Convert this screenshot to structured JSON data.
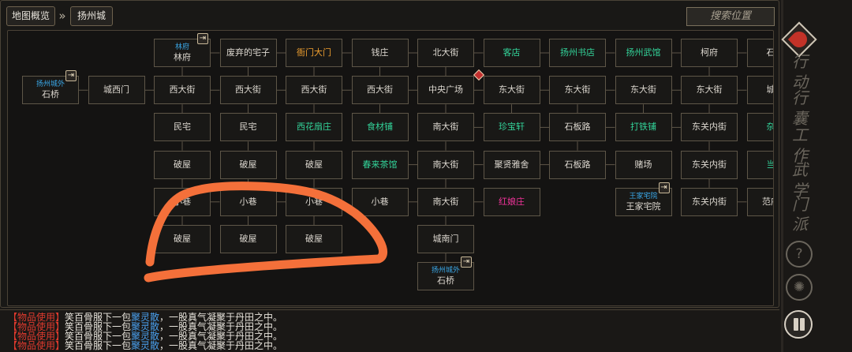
{
  "header": {
    "overview_label": "地图概览",
    "city_label": "扬州城",
    "search_placeholder": "搜索位置"
  },
  "map": {
    "nodes": [
      {
        "id": "r0c0",
        "row": 0,
        "col": 2,
        "name": "林府",
        "sub": "林府",
        "exit": true
      },
      {
        "id": "r0c1",
        "row": 0,
        "col": 3,
        "name": "废弃的宅子"
      },
      {
        "id": "r0c2",
        "row": 0,
        "col": 4,
        "name": "衙门大门",
        "style": "orange"
      },
      {
        "id": "r0c3",
        "row": 0,
        "col": 5,
        "name": "钱庄"
      },
      {
        "id": "r0c4",
        "row": 0,
        "col": 6,
        "name": "北大街"
      },
      {
        "id": "r0c5",
        "row": 0,
        "col": 7,
        "name": "客店",
        "style": "green"
      },
      {
        "id": "r0c6",
        "row": 0,
        "col": 8,
        "name": "扬州书店",
        "style": "green"
      },
      {
        "id": "r0c7",
        "row": 0,
        "col": 9,
        "name": "扬州武馆",
        "style": "green"
      },
      {
        "id": "r0c8",
        "row": 0,
        "col": 10,
        "name": "柯府"
      },
      {
        "id": "r0c9",
        "row": 0,
        "col": 11,
        "name": "石板"
      },
      {
        "id": "r1c0",
        "row": 1,
        "col": 0,
        "name": "石桥",
        "sub": "扬州城外",
        "exit": true
      },
      {
        "id": "r1c1",
        "row": 1,
        "col": 1,
        "name": "城西门"
      },
      {
        "id": "r1c2",
        "row": 1,
        "col": 2,
        "name": "西大街"
      },
      {
        "id": "r1c3",
        "row": 1,
        "col": 3,
        "name": "西大街"
      },
      {
        "id": "r1c4",
        "row": 1,
        "col": 4,
        "name": "西大街"
      },
      {
        "id": "r1c5",
        "row": 1,
        "col": 5,
        "name": "西大街"
      },
      {
        "id": "r1c6",
        "row": 1,
        "col": 6,
        "name": "中央广场",
        "marker": true
      },
      {
        "id": "r1c7",
        "row": 1,
        "col": 7,
        "name": "东大街"
      },
      {
        "id": "r1c8",
        "row": 1,
        "col": 8,
        "name": "东大街"
      },
      {
        "id": "r1c9",
        "row": 1,
        "col": 9,
        "name": "东大街"
      },
      {
        "id": "r1c10",
        "row": 1,
        "col": 10,
        "name": "东大街"
      },
      {
        "id": "r1c11",
        "row": 1,
        "col": 11,
        "name": "城东"
      },
      {
        "id": "r2c2",
        "row": 2,
        "col": 2,
        "name": "民宅"
      },
      {
        "id": "r2c3",
        "row": 2,
        "col": 3,
        "name": "民宅"
      },
      {
        "id": "r2c4",
        "row": 2,
        "col": 4,
        "name": "西花扇庄",
        "style": "green"
      },
      {
        "id": "r2c5",
        "row": 2,
        "col": 5,
        "name": "食材铺",
        "style": "green"
      },
      {
        "id": "r2c6",
        "row": 2,
        "col": 6,
        "name": "南大街"
      },
      {
        "id": "r2c7",
        "row": 2,
        "col": 7,
        "name": "珍宝轩",
        "style": "green"
      },
      {
        "id": "r2c8",
        "row": 2,
        "col": 8,
        "name": "石板路"
      },
      {
        "id": "r2c9",
        "row": 2,
        "col": 9,
        "name": "打铁铺",
        "style": "green"
      },
      {
        "id": "r2c10",
        "row": 2,
        "col": 10,
        "name": "东关内街"
      },
      {
        "id": "r2c11",
        "row": 2,
        "col": 11,
        "name": "杂货",
        "style": "green"
      },
      {
        "id": "r3c2",
        "row": 3,
        "col": 2,
        "name": "破屋"
      },
      {
        "id": "r3c3",
        "row": 3,
        "col": 3,
        "name": "破屋"
      },
      {
        "id": "r3c4",
        "row": 3,
        "col": 4,
        "name": "破屋"
      },
      {
        "id": "r3c5",
        "row": 3,
        "col": 5,
        "name": "春来茶馆",
        "style": "green"
      },
      {
        "id": "r3c6",
        "row": 3,
        "col": 6,
        "name": "南大街"
      },
      {
        "id": "r3c7",
        "row": 3,
        "col": 7,
        "name": "聚贤雅舍"
      },
      {
        "id": "r3c8",
        "row": 3,
        "col": 8,
        "name": "石板路"
      },
      {
        "id": "r3c9",
        "row": 3,
        "col": 9,
        "name": "赌场"
      },
      {
        "id": "r3c10",
        "row": 3,
        "col": 10,
        "name": "东关内街"
      },
      {
        "id": "r3c11",
        "row": 3,
        "col": 11,
        "name": "当铺",
        "style": "green"
      },
      {
        "id": "r4c2",
        "row": 4,
        "col": 2,
        "name": "小巷"
      },
      {
        "id": "r4c3",
        "row": 4,
        "col": 3,
        "name": "小巷"
      },
      {
        "id": "r4c4",
        "row": 4,
        "col": 4,
        "name": "小巷"
      },
      {
        "id": "r4c5",
        "row": 4,
        "col": 5,
        "name": "小巷"
      },
      {
        "id": "r4c6",
        "row": 4,
        "col": 6,
        "name": "南大街"
      },
      {
        "id": "r4c7",
        "row": 4,
        "col": 7,
        "name": "红娘庄",
        "style": "pink"
      },
      {
        "id": "r4c9",
        "row": 4,
        "col": 9,
        "name": "王家宅院",
        "sub": "王家宅院",
        "exit": true
      },
      {
        "id": "r4c10",
        "row": 4,
        "col": 10,
        "name": "东关内街"
      },
      {
        "id": "r4c11",
        "row": 4,
        "col": 11,
        "name": "范府门"
      },
      {
        "id": "r5c2",
        "row": 5,
        "col": 2,
        "name": "破屋"
      },
      {
        "id": "r5c3",
        "row": 5,
        "col": 3,
        "name": "破屋"
      },
      {
        "id": "r5c4",
        "row": 5,
        "col": 4,
        "name": "破屋"
      },
      {
        "id": "r5c6",
        "row": 5,
        "col": 6,
        "name": "城南门"
      },
      {
        "id": "r6c6",
        "row": 6,
        "col": 6,
        "name": "石桥",
        "sub": "扬州城外",
        "exit": true
      }
    ],
    "links_h": [
      [
        1,
        0,
        1
      ],
      [
        1,
        1,
        2
      ],
      [
        1,
        2,
        3
      ],
      [
        1,
        3,
        4
      ],
      [
        1,
        4,
        5
      ],
      [
        1,
        5,
        6
      ],
      [
        1,
        6,
        7
      ],
      [
        1,
        7,
        8
      ],
      [
        1,
        8,
        9
      ],
      [
        1,
        9,
        10
      ],
      [
        1,
        10,
        11
      ],
      [
        0,
        2,
        3
      ],
      [
        0,
        3,
        4
      ],
      [
        0,
        4,
        5
      ],
      [
        0,
        5,
        6
      ],
      [
        0,
        6,
        7
      ],
      [
        0,
        7,
        8
      ],
      [
        0,
        8,
        9
      ],
      [
        0,
        9,
        10
      ],
      [
        0,
        10,
        11
      ],
      [
        2,
        6,
        7
      ],
      [
        2,
        7,
        8
      ],
      [
        2,
        8,
        9
      ],
      [
        2,
        9,
        10
      ],
      [
        3,
        5,
        6
      ],
      [
        3,
        6,
        7
      ],
      [
        3,
        7,
        8
      ],
      [
        3,
        8,
        9
      ],
      [
        4,
        2,
        3
      ],
      [
        4,
        3,
        4
      ],
      [
        4,
        5,
        6
      ],
      [
        4,
        6,
        7
      ],
      [
        4,
        10,
        11
      ]
    ],
    "links_v": [
      [
        2,
        0,
        1
      ],
      [
        2,
        1,
        2
      ],
      [
        2,
        2,
        3
      ],
      [
        2,
        3,
        4
      ],
      [
        2,
        4,
        5
      ],
      [
        3,
        0,
        1
      ],
      [
        3,
        1,
        2
      ],
      [
        3,
        2,
        3
      ],
      [
        3,
        3,
        4
      ],
      [
        3,
        4,
        5
      ],
      [
        4,
        0,
        1
      ],
      [
        4,
        1,
        2
      ],
      [
        4,
        2,
        3
      ],
      [
        4,
        3,
        4
      ],
      [
        4,
        4,
        5
      ],
      [
        5,
        0,
        1
      ],
      [
        5,
        1,
        2
      ],
      [
        6,
        0,
        1
      ],
      [
        6,
        1,
        2
      ],
      [
        6,
        2,
        3
      ],
      [
        6,
        3,
        4
      ],
      [
        6,
        4,
        5
      ],
      [
        6,
        5,
        6
      ],
      [
        7,
        1,
        2
      ],
      [
        8,
        1,
        2
      ],
      [
        8,
        2,
        3
      ],
      [
        9,
        1,
        2
      ],
      [
        10,
        0,
        1
      ],
      [
        10,
        1,
        2
      ],
      [
        10,
        2,
        3
      ],
      [
        10,
        3,
        4
      ],
      [
        11,
        0,
        1
      ],
      [
        11,
        1,
        2
      ],
      [
        11,
        2,
        3
      ],
      [
        11,
        3,
        4
      ]
    ]
  },
  "log": [
    {
      "tag": "【物品使用】",
      "text1": "笑百骨服下一包",
      "item": "聚灵散",
      "text2": "，一股真气凝聚于丹田之中。"
    },
    {
      "tag": "【物品使用】",
      "text1": "笑百骨服下一包",
      "item": "聚灵散",
      "text2": "，一股真气凝聚于丹田之中。"
    },
    {
      "tag": "【物品使用】",
      "text1": "笑百骨服下一包",
      "item": "聚灵散",
      "text2": "，一股真气凝聚于丹田之中。"
    },
    {
      "tag": "【物品使用】",
      "text1": "笑百骨服下一包",
      "item": "聚灵散",
      "text2": "，一股真气凝聚于丹田之中。"
    }
  ],
  "sidebar": {
    "glyphs": [
      {
        "name": "xingdong-icon",
        "char": "行"
      },
      {
        "name": "dong-icon",
        "char": "动"
      },
      {
        "name": "xing2-icon",
        "char": "行"
      },
      {
        "name": "nang-icon",
        "char": "囊"
      },
      {
        "name": "gong-icon",
        "char": "工"
      },
      {
        "name": "zuo-icon",
        "char": "作"
      },
      {
        "name": "wu-icon",
        "char": "武"
      },
      {
        "name": "xue-icon",
        "char": "学"
      },
      {
        "name": "men-icon",
        "char": "门"
      },
      {
        "name": "pai-icon",
        "char": "派"
      }
    ],
    "help_char": "?",
    "gear_char": "✺"
  },
  "colors": {
    "accent_green": "#33d49a",
    "accent_orange": "#f0a030",
    "accent_pink": "#ee3399",
    "accent_blue": "#3aa8e8",
    "accent_red": "#e03a2e",
    "annotation_orange": "#f4703a"
  }
}
